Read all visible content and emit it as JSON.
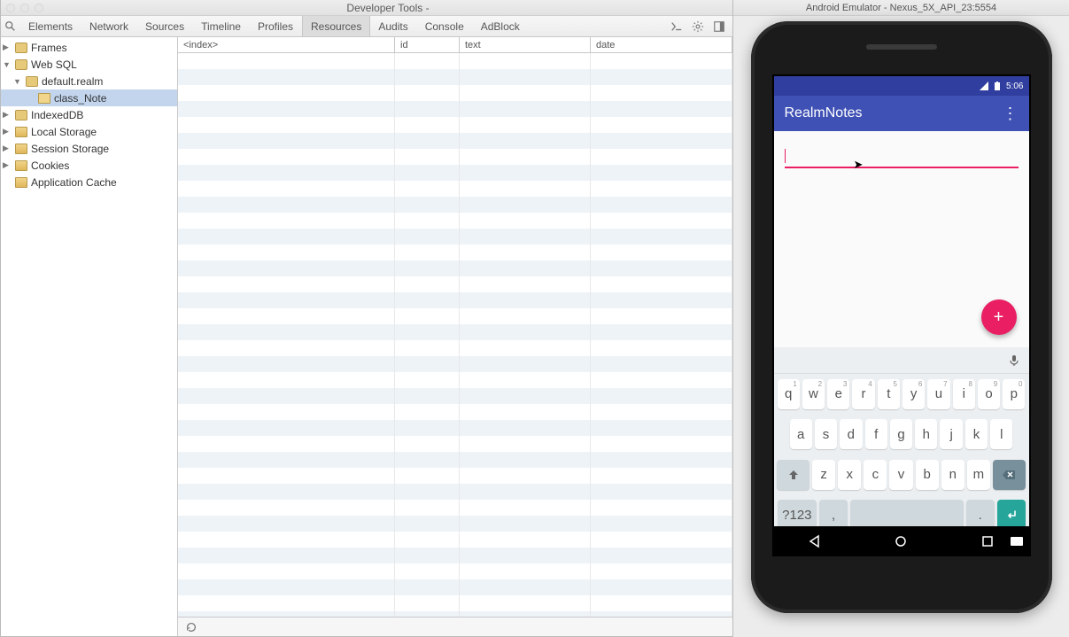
{
  "devtools": {
    "title": "Developer Tools -",
    "tabs": [
      "Elements",
      "Network",
      "Sources",
      "Timeline",
      "Profiles",
      "Resources",
      "Audits",
      "Console",
      "AdBlock"
    ],
    "active_tab": "Resources",
    "sidebar": {
      "frames": "Frames",
      "websql": "Web SQL",
      "db_file": "default.realm",
      "db_table": "class_Note",
      "indexeddb": "IndexedDB",
      "local_storage": "Local Storage",
      "session_storage": "Session Storage",
      "cookies": "Cookies",
      "appcache": "Application Cache"
    },
    "grid": {
      "headers": {
        "index": "<index>",
        "id": "id",
        "text": "text",
        "date": "date"
      },
      "rows": []
    }
  },
  "emulator": {
    "title": "Android Emulator - Nexus_5X_API_23:5554",
    "statusbar": {
      "time": "5:06"
    },
    "app": {
      "title": "RealmNotes",
      "note_value": "",
      "fab_label": "+"
    },
    "keyboard": {
      "row1": [
        {
          "k": "q",
          "s": "1"
        },
        {
          "k": "w",
          "s": "2"
        },
        {
          "k": "e",
          "s": "3"
        },
        {
          "k": "r",
          "s": "4"
        },
        {
          "k": "t",
          "s": "5"
        },
        {
          "k": "y",
          "s": "6"
        },
        {
          "k": "u",
          "s": "7"
        },
        {
          "k": "i",
          "s": "8"
        },
        {
          "k": "o",
          "s": "9"
        },
        {
          "k": "p",
          "s": "0"
        }
      ],
      "row2": [
        "a",
        "s",
        "d",
        "f",
        "g",
        "h",
        "j",
        "k",
        "l"
      ],
      "row3": [
        "z",
        "x",
        "c",
        "v",
        "b",
        "n",
        "m"
      ],
      "sym": "?123",
      "comma": ",",
      "period": "."
    }
  }
}
